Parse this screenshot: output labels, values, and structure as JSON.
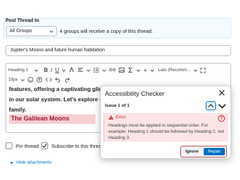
{
  "post_thread": {
    "label": "Post Thread to",
    "group_value": "All Groups",
    "groups_note": "4 groups will receive a copy of this thread."
  },
  "subject": {
    "value": "Jupiter's Moons and future human habitation"
  },
  "toolbar": {
    "heading_select": "Heading 1",
    "font_size": "19px",
    "font_family": "Lato (Recomm..."
  },
  "editor": {
    "line1": "features, offering a captivating glimpse into the diversity and complexity of celestial bodies",
    "line2": "in our solar system. Let's explore some",
    "line3": "family.",
    "heading": "The Galilean Moons"
  },
  "options": {
    "pin_label": "Pin thread",
    "subscribe_label": "Subscribe to this thread",
    "hide_attachments": "Hide attachments"
  },
  "dialog": {
    "title": "Accessibility Checker",
    "issue_label": "Issue 1 of 1",
    "error_label": "Error",
    "error_text": "Headings must be applied in sequential order. For example: Heading 1 should be followed by Heading 2, not Heading 3.",
    "ignore_label": "Ignore",
    "repair_label": "Repair"
  },
  "colors": {
    "accent": "#006fbf",
    "error": "#cd2026",
    "error_bg": "#fbe5e7",
    "heading_highlight": "#f7d0d3"
  }
}
